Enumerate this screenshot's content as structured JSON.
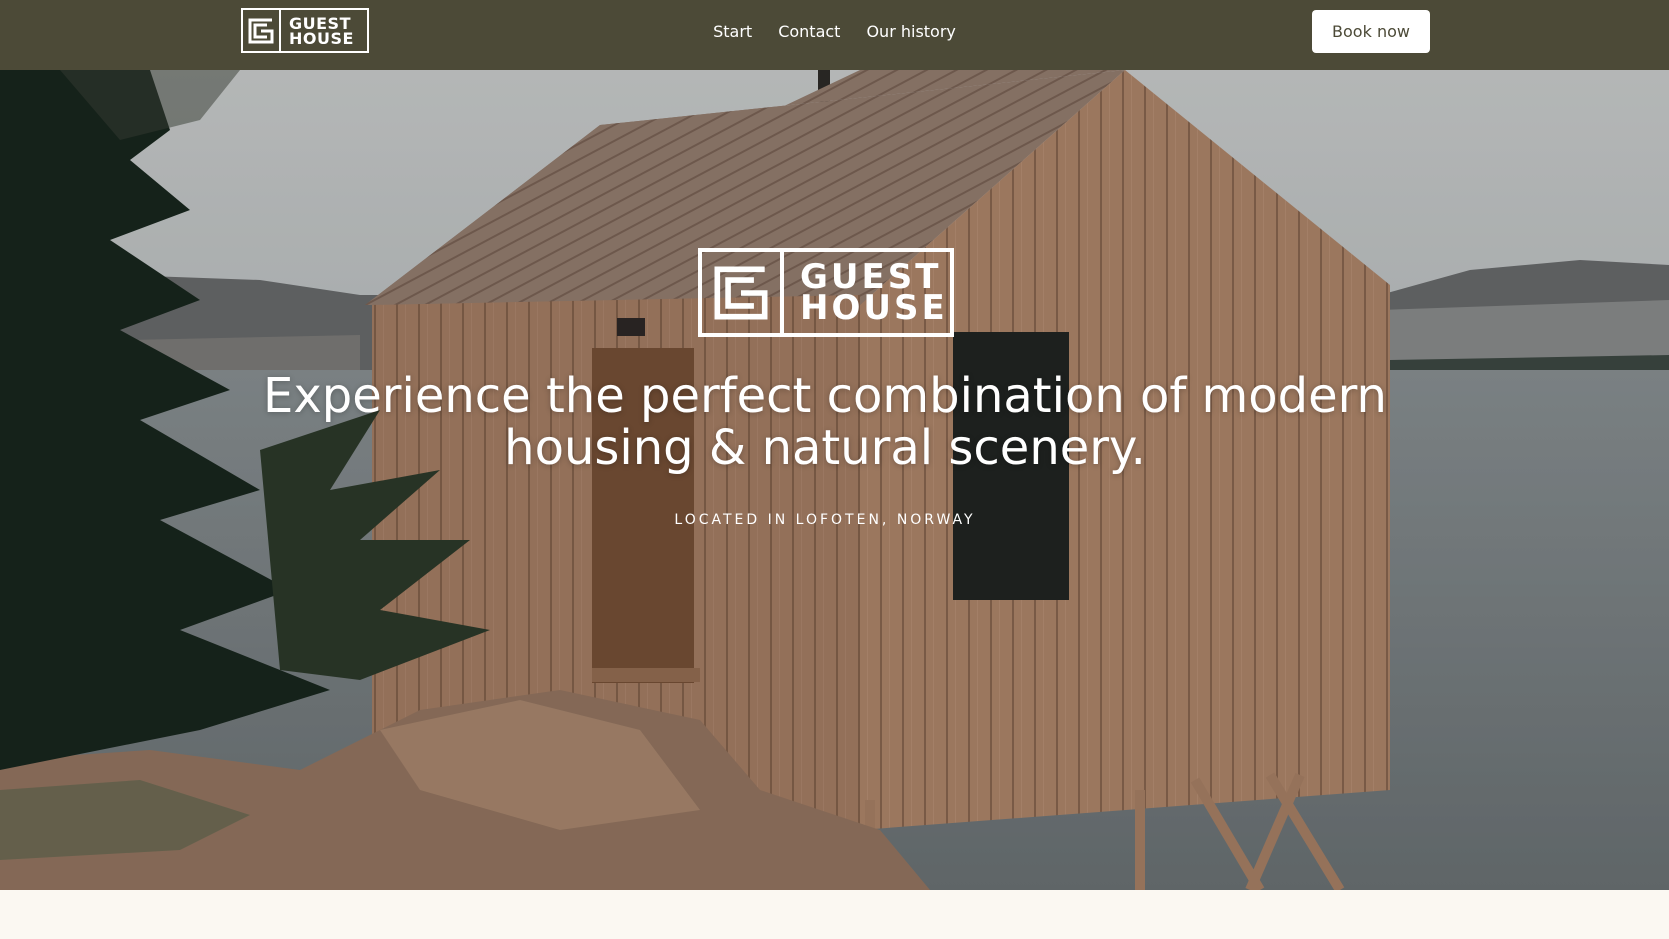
{
  "header": {
    "logo": {
      "line1": "GUEST",
      "line2": "HOUSE"
    },
    "nav": [
      {
        "label": "Start"
      },
      {
        "label": "Contact"
      },
      {
        "label": "Our history"
      }
    ],
    "cta_label": "Book now"
  },
  "hero": {
    "logo": {
      "line1": "GUEST",
      "line2": "HOUSE"
    },
    "headline": "Experience the perfect combination of modern housing & natural scenery.",
    "subline": "LOCATED IN LOFOTEN, NORWAY"
  },
  "colors": {
    "header_bg": "#4c4a37",
    "page_bg": "#fbf8f2",
    "text_light": "#ffffff",
    "wood": "#b48a6d"
  }
}
